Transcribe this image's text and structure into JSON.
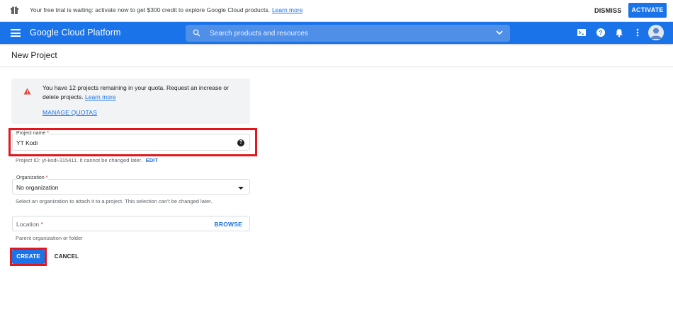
{
  "trial_banner": {
    "message": "Your free trial is waiting: activate now to get $300 credit to explore Google Cloud products.",
    "learn_more": "Learn more",
    "dismiss_label": "DISMISS",
    "activate_label": "ACTIVATE"
  },
  "appbar": {
    "brand": "Google Cloud Platform",
    "search_placeholder": "Search products and resources",
    "icons": [
      "cloud-shell-icon",
      "help-icon",
      "notifications-icon",
      "more-vert-icon",
      "account-avatar"
    ],
    "color": "#1a73e8"
  },
  "page": {
    "title": "New Project"
  },
  "quota_notice": {
    "message": "You have 12 projects remaining in your quota. Request an increase or delete projects.",
    "learn_more": "Learn more",
    "manage_quotas": "MANAGE QUOTAS"
  },
  "form": {
    "project_name": {
      "label": "Project name",
      "required_mark": "*",
      "value": "YT Kodi"
    },
    "project_id_helper": "Project ID: yt-kodi-315411. It cannot be changed later.",
    "edit_label": "EDIT",
    "organization": {
      "label": "Organization",
      "required_mark": "*",
      "value": "No organization",
      "helper": "Select an organization to attach it to a project. This selection can't be changed later."
    },
    "location": {
      "label": "Location",
      "required_mark": "*",
      "browse_label": "BROWSE",
      "helper": "Parent organization or folder"
    }
  },
  "actions": {
    "create_label": "CREATE",
    "cancel_label": "CANCEL"
  },
  "highlight_color": "#e3161c"
}
